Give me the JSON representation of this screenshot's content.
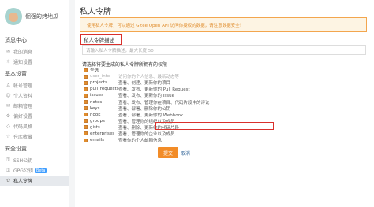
{
  "sidebar": {
    "username": "倔强的烤地瓜",
    "sections": [
      {
        "title": "消息中心",
        "items": [
          {
            "label": "我的消息",
            "icon": "bell-icon",
            "glyph": "✉"
          },
          {
            "label": "通知设置",
            "icon": "bell-settings-icon",
            "glyph": "☼"
          }
        ]
      },
      {
        "title": "基本设置",
        "items": [
          {
            "label": "帐号管理",
            "icon": "user-icon",
            "glyph": "♙"
          },
          {
            "label": "个人资料",
            "icon": "profile-icon",
            "glyph": "☺"
          },
          {
            "label": "邮箱管理",
            "icon": "mail-icon",
            "glyph": "✉"
          },
          {
            "label": "偏好设置",
            "icon": "preferences-icon",
            "glyph": "⚙"
          },
          {
            "label": "代码风格",
            "icon": "code-icon",
            "glyph": "◇"
          },
          {
            "label": "仓库收藏",
            "icon": "star-icon",
            "glyph": "☆"
          }
        ]
      },
      {
        "title": "安全设置",
        "items": [
          {
            "label": "SSH公钥",
            "icon": "key-icon",
            "glyph": "⚿"
          },
          {
            "label": "GPG公钥",
            "icon": "gpg-key-icon",
            "glyph": "⚿",
            "badge": "Beta"
          },
          {
            "label": "私人令牌",
            "icon": "token-icon",
            "glyph": "✿",
            "active": true
          }
        ]
      }
    ]
  },
  "main": {
    "title": "私人令牌",
    "banner": "使用私人令牌，可以通过 Gitee Open API 访问你授权的数据，请注意数据安全！",
    "description_label": "私人令牌描述",
    "description_placeholder": "请输入私人令牌描述，最大长度 50",
    "perm_heading": "请选择将要生成的私人令牌所拥有的权限",
    "permissions": [
      {
        "name": "全选",
        "desc": "",
        "checked": true,
        "muted": false
      },
      {
        "name": "user_info",
        "desc": "访问你的个人信息、最新动态等",
        "checked": true,
        "muted": true
      },
      {
        "name": "projects",
        "desc": "查看、创建、更新你的项目",
        "checked": true,
        "muted": false
      },
      {
        "name": "pull_requests",
        "desc": "查看、发布、更新你的 Pull Request",
        "checked": true,
        "muted": false
      },
      {
        "name": "issues",
        "desc": "查看、发布、更新你的 Issue",
        "checked": true,
        "muted": false
      },
      {
        "name": "notes",
        "desc": "查看、发布、管理你在项目、代码片段中的评论",
        "checked": true,
        "muted": false
      },
      {
        "name": "keys",
        "desc": "查看、部署、删除你的公钥",
        "checked": true,
        "muted": false
      },
      {
        "name": "hook",
        "desc": "查看、部署、更新你的 Webhook",
        "checked": true,
        "muted": false
      },
      {
        "name": "groups",
        "desc": "查看、管理你的组织以及成员",
        "checked": true,
        "muted": false
      },
      {
        "name": "gists",
        "desc": "查看、删除、更新你的代码片段",
        "checked": true,
        "muted": false
      },
      {
        "name": "enterprises",
        "desc": "查看、管理你的企业以及成员",
        "checked": true,
        "muted": false
      },
      {
        "name": "emails",
        "desc": "查看你的个人邮箱信息",
        "checked": true,
        "muted": false
      }
    ],
    "submit_label": "提交",
    "cancel_label": "取消"
  },
  "colors": {
    "accent": "#f28c28",
    "banner_bg": "#fdf4e3",
    "highlight": "#d9302c"
  }
}
